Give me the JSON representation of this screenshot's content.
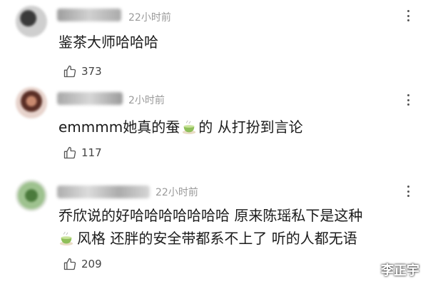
{
  "comments": [
    {
      "time": "22小时前",
      "text": "鉴茶大师哈哈哈",
      "likes": "373"
    },
    {
      "time": "2小时前",
      "text_a": "emmmm她真的蚕",
      "text_b": "的 从打扮到言论",
      "likes": "117"
    },
    {
      "time": "22小时前",
      "line1": "乔欣说的好哈哈哈哈哈哈哈 原来陈瑶私下是这种",
      "line2": "风格 还胖的安全带都系不上了 听的人都无语",
      "likes": "209"
    }
  ],
  "icons": {
    "like": "thumbs-up-icon",
    "more": "more-vertical-icon",
    "tea": "tea-emoji-icon"
  },
  "watermark": "李正宇"
}
